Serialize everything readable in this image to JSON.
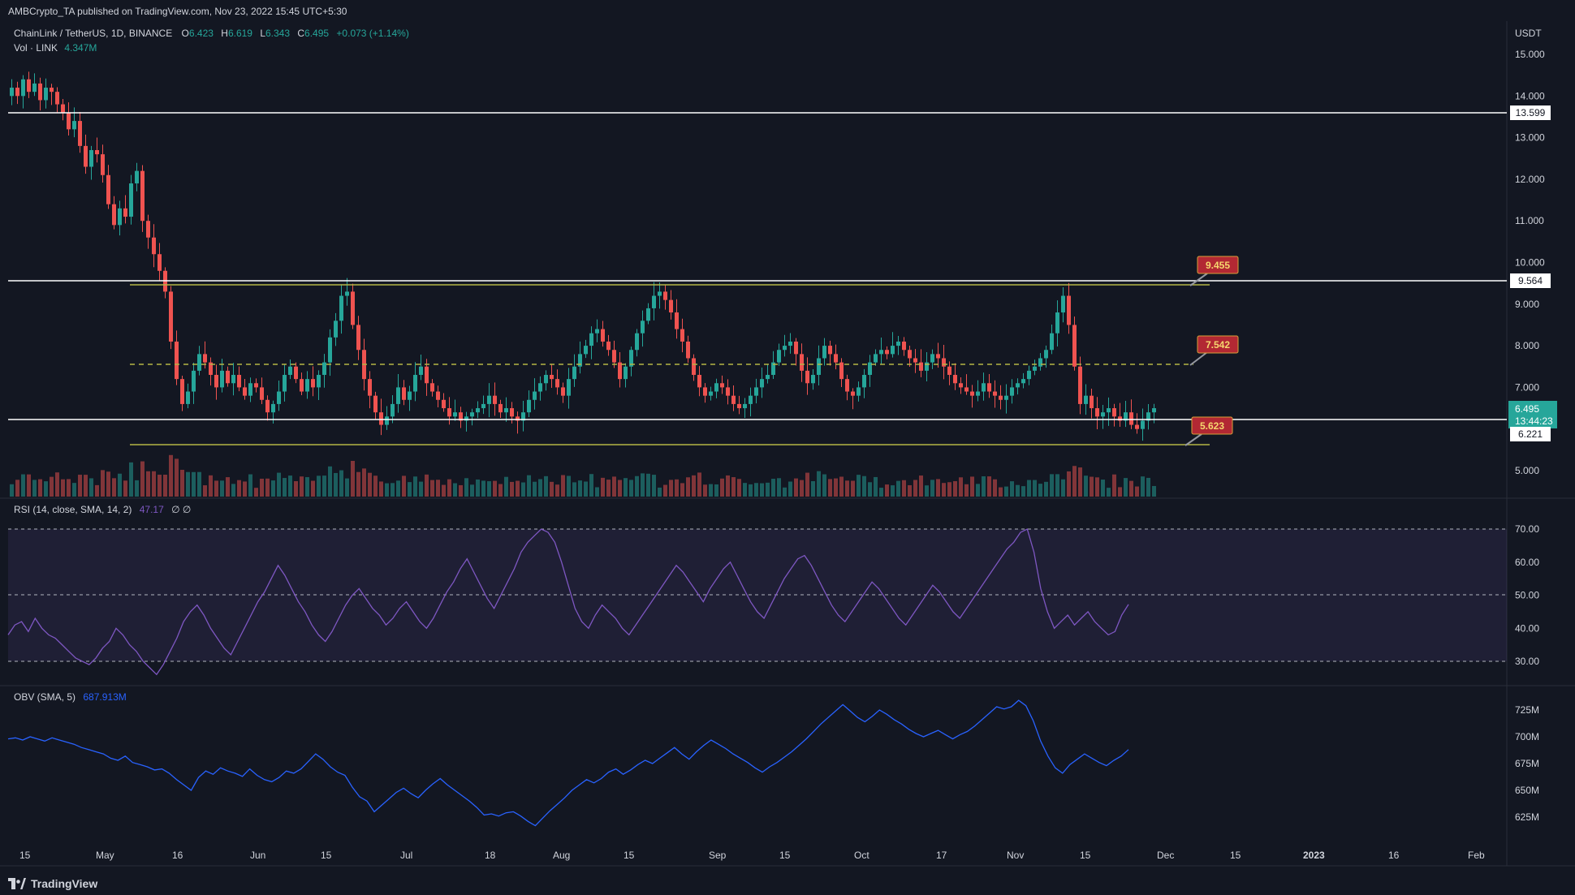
{
  "header": {
    "published_line": "AMBCrypto_TA published on TradingView.com, Nov 23, 2022 15:45 UTC+5:30"
  },
  "legend": {
    "symbol": "ChainLink / TetherUS, 1D, BINANCE",
    "o_label": "O",
    "o_value": "6.423",
    "h_label": "H",
    "h_value": "6.619",
    "l_label": "L",
    "l_value": "6.343",
    "c_label": "C",
    "c_value": "6.495",
    "change": "+0.073 (+1.14%)",
    "vol_label": "Vol · LINK",
    "vol_value": "4.347M"
  },
  "rsi_legend": {
    "label": "RSI (14, close, SMA, 14, 2)",
    "value": "47.17",
    "extra": "∅ ∅"
  },
  "obv_legend": {
    "label": "OBV (SMA, 5)",
    "value": "687.913M"
  },
  "currency": "USDT",
  "price_badges": {
    "current": "6.495",
    "countdown": "13:44:23",
    "support": "6.221",
    "resistance_high": "13.599",
    "resistance_mid": "9.564"
  },
  "callouts": [
    "9.455",
    "7.542",
    "5.623"
  ],
  "footer": {
    "brand": "TradingView"
  },
  "colors": {
    "up": "#26a69a",
    "down": "#ef5350",
    "rsi": "#7e57c2",
    "obv": "#2962ff",
    "level": "#b5b545",
    "background": "#131722"
  },
  "chart_data": [
    {
      "type": "candlestick",
      "title": "ChainLink / TetherUS, 1D, BINANCE",
      "ylabel": "USDT",
      "ylim": [
        4.3,
        15.4
      ],
      "y_ticks": [
        "15.000",
        "14.000",
        "13.000",
        "12.000",
        "11.000",
        "10.000",
        "9.000",
        "8.000",
        "7.000",
        "5.000"
      ],
      "x_ticks": [
        "15",
        "May",
        "16",
        "Jun",
        "15",
        "Jul",
        "18",
        "Aug",
        "15",
        "Sep",
        "15",
        "Oct",
        "17",
        "Nov",
        "15",
        "Dec",
        "15",
        "2023",
        "16",
        "Feb"
      ],
      "close_series": [
        14.2,
        14.0,
        14.4,
        14.1,
        14.3,
        13.9,
        14.2,
        14.1,
        13.8,
        13.6,
        13.2,
        13.4,
        12.8,
        12.3,
        12.7,
        12.6,
        12.1,
        11.4,
        10.9,
        11.3,
        11.1,
        11.9,
        12.2,
        11.0,
        10.6,
        10.2,
        9.8,
        9.3,
        8.1,
        7.2,
        6.6,
        6.9,
        7.4,
        7.8,
        7.6,
        7.3,
        7.0,
        7.4,
        7.1,
        7.3,
        7.0,
        6.8,
        7.1,
        7.0,
        6.7,
        6.4,
        6.6,
        6.9,
        7.3,
        7.5,
        7.2,
        6.9,
        7.2,
        7.0,
        7.3,
        7.6,
        8.2,
        8.6,
        9.2,
        9.3,
        8.5,
        7.9,
        7.2,
        6.8,
        6.4,
        6.1,
        6.3,
        6.6,
        7.0,
        6.7,
        6.9,
        7.3,
        7.5,
        7.1,
        6.9,
        6.7,
        6.5,
        6.3,
        6.4,
        6.2,
        6.3,
        6.4,
        6.5,
        6.6,
        6.8,
        6.6,
        6.4,
        6.5,
        6.3,
        6.2,
        6.4,
        6.7,
        6.9,
        7.1,
        7.3,
        7.2,
        7.0,
        6.8,
        7.2,
        7.5,
        7.8,
        8.0,
        8.3,
        8.4,
        8.1,
        7.9,
        7.6,
        7.2,
        7.5,
        7.9,
        8.3,
        8.6,
        8.9,
        9.2,
        9.3,
        9.1,
        8.8,
        8.4,
        8.1,
        7.7,
        7.3,
        7.0,
        6.8,
        6.9,
        7.1,
        7.0,
        6.8,
        6.6,
        6.5,
        6.6,
        6.8,
        7.0,
        7.2,
        7.3,
        7.6,
        7.9,
        8.0,
        8.1,
        7.8,
        7.4,
        7.1,
        7.3,
        7.7,
        8.0,
        7.8,
        7.6,
        7.2,
        6.9,
        6.8,
        7.0,
        7.3,
        7.6,
        7.8,
        7.9,
        7.8,
        8.0,
        8.1,
        7.9,
        7.7,
        7.6,
        7.4,
        7.6,
        7.8,
        7.7,
        7.5,
        7.3,
        7.1,
        7.0,
        6.9,
        6.8,
        6.9,
        7.1,
        6.9,
        6.8,
        6.7,
        6.8,
        7.0,
        7.1,
        7.2,
        7.4,
        7.5,
        7.7,
        7.9,
        8.3,
        8.8,
        9.2,
        8.5,
        7.5,
        6.6,
        6.8,
        6.5,
        6.3,
        6.4,
        6.5,
        6.3,
        6.2,
        6.4,
        6.1,
        6.0,
        6.2,
        6.4,
        6.5
      ]
    },
    {
      "type": "bar",
      "title": "Vol · LINK",
      "ylabel": "",
      "description": "volume histogram coloured by candle direction"
    },
    {
      "type": "line",
      "title": "RSI (14, close, SMA, 14, 2)",
      "ylim": [
        25,
        73
      ],
      "y_ticks": [
        "70.00",
        "60.00",
        "50.00",
        "40.00",
        "30.00"
      ],
      "bands": {
        "upper": 70,
        "middle": 50,
        "lower": 30
      },
      "values": [
        38,
        41,
        42,
        39,
        43,
        40,
        38,
        37,
        35,
        33,
        31,
        30,
        29,
        31,
        34,
        36,
        40,
        38,
        35,
        33,
        30,
        28,
        26,
        29,
        33,
        37,
        42,
        45,
        47,
        44,
        40,
        37,
        34,
        32,
        36,
        40,
        44,
        48,
        51,
        55,
        59,
        56,
        52,
        48,
        45,
        41,
        38,
        36,
        39,
        43,
        47,
        50,
        52,
        49,
        46,
        44,
        41,
        43,
        46,
        48,
        45,
        42,
        40,
        43,
        47,
        51,
        54,
        58,
        61,
        57,
        53,
        49,
        46,
        50,
        54,
        58,
        63,
        66,
        68,
        70,
        69,
        66,
        60,
        53,
        46,
        42,
        40,
        44,
        47,
        45,
        43,
        40,
        38,
        41,
        44,
        47,
        50,
        53,
        56,
        59,
        57,
        54,
        51,
        48,
        52,
        55,
        58,
        60,
        56,
        52,
        48,
        45,
        43,
        47,
        51,
        55,
        58,
        61,
        62,
        59,
        55,
        51,
        47,
        44,
        42,
        45,
        48,
        51,
        54,
        52,
        49,
        46,
        43,
        41,
        44,
        47,
        50,
        53,
        51,
        48,
        45,
        43,
        46,
        49,
        52,
        55,
        58,
        61,
        64,
        66,
        69,
        70,
        63,
        52,
        45,
        40,
        42,
        44,
        41,
        43,
        45,
        42,
        40,
        38,
        39,
        44,
        47.2
      ]
    },
    {
      "type": "line",
      "title": "OBV (SMA, 5)",
      "ylim": [
        612,
        738
      ],
      "y_ticks": [
        "725M",
        "700M",
        "675M",
        "650M",
        "625M"
      ],
      "values": [
        698,
        699,
        697,
        700,
        698,
        696,
        699,
        697,
        695,
        693,
        690,
        688,
        686,
        684,
        680,
        678,
        682,
        676,
        674,
        672,
        669,
        670,
        666,
        660,
        655,
        650,
        662,
        668,
        665,
        671,
        668,
        666,
        663,
        670,
        664,
        660,
        658,
        662,
        668,
        666,
        670,
        677,
        684,
        679,
        672,
        667,
        664,
        653,
        644,
        640,
        630,
        636,
        642,
        648,
        652,
        647,
        643,
        650,
        656,
        661,
        655,
        650,
        645,
        640,
        634,
        627,
        628,
        626,
        629,
        630,
        626,
        621,
        617,
        624,
        631,
        637,
        643,
        650,
        655,
        660,
        657,
        661,
        667,
        670,
        665,
        669,
        674,
        678,
        675,
        680,
        685,
        690,
        684,
        679,
        686,
        692,
        697,
        693,
        689,
        684,
        680,
        676,
        671,
        667,
        672,
        676,
        681,
        686,
        692,
        698,
        705,
        712,
        718,
        724,
        730,
        724,
        718,
        714,
        719,
        725,
        721,
        716,
        712,
        707,
        703,
        700,
        703,
        706,
        702,
        698,
        702,
        705,
        710,
        716,
        722,
        728,
        726,
        728,
        734,
        729,
        715,
        696,
        682,
        671,
        666,
        674,
        679,
        684,
        680,
        676,
        673,
        678,
        682,
        688
      ]
    }
  ]
}
